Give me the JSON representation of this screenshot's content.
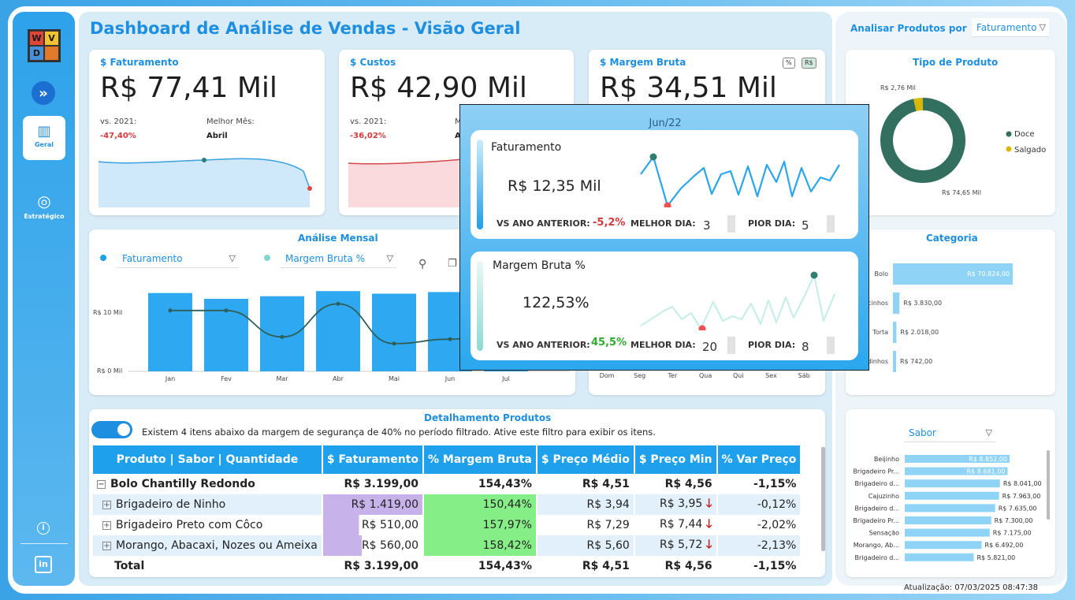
{
  "app": {
    "title": "Dashboard de Análise de Vendas - Visão Geral",
    "update": "Atualização: 07/03/2025 08:47:38"
  },
  "sidebar": {
    "logo_letters": [
      "W",
      "V",
      "D",
      ""
    ],
    "nav": [
      {
        "label": "Geral",
        "icon": "bar-chart-add-icon"
      },
      {
        "label": "Estratégico",
        "icon": "target-icon"
      }
    ]
  },
  "kpis": {
    "faturamento": {
      "label": "$ Faturamento",
      "value": "R$ 77,41 Mil",
      "vs_label": "vs. 2021:",
      "vs_value": "-47,40%",
      "best_label": "Melhor Mês:",
      "best_value": "Abril"
    },
    "custos": {
      "label": "$ Custos",
      "value": "R$ 42,90 Mil",
      "vs_label": "vs. 2021:",
      "vs_value": "-36,02%",
      "best_label": "M",
      "best_value": "A"
    },
    "margem": {
      "label": "$ Margem Bruta",
      "value": "R$ 34,51 Mil",
      "btn_pct": "%",
      "btn_rs": "R$"
    }
  },
  "monthly": {
    "title": "Análise Mensal",
    "dd1": "Faturamento",
    "dd2": "Margem Bruta %",
    "y_labels": [
      "R$ 10 Mil",
      "R$ 0 Mil"
    ],
    "chart_data": {
      "type": "bar",
      "categories": [
        "Jan",
        "Fev",
        "Mar",
        "Abr",
        "Mai",
        "Jun",
        "Jul"
      ],
      "values": [
        12.2,
        11.3,
        11.7,
        12.5,
        12.1,
        12.35,
        6.0
      ],
      "line_values": [
        145,
        145,
        85,
        160,
        70,
        80,
        100
      ],
      "ylim": [
        0,
        14
      ]
    }
  },
  "weekday": {
    "categories": [
      "Dom",
      "Seg",
      "Ter",
      "Qua",
      "Qui",
      "Sex",
      "Sáb"
    ]
  },
  "tooltip": {
    "title": "Jun/22",
    "fat": {
      "label": "Faturamento",
      "value": "R$ 12,35 Mil",
      "vs_label": "VS ANO ANTERIOR:",
      "vs_value": "-5,2%",
      "best_label": "MELHOR DIA:",
      "best_value": "3",
      "worst_label": "PIOR DIA:",
      "worst_value": "5"
    },
    "mar": {
      "label": "Margem Bruta %",
      "value": "122,53%",
      "vs_label": "VS ANO ANTERIOR:",
      "vs_value": "45,5%",
      "best_label": "MELHOR DIA:",
      "best_value": "20",
      "worst_label": "PIOR DIA:",
      "worst_value": "8"
    }
  },
  "products": {
    "title": "Detalhamento Produtos",
    "toggle_text": "Existem 4 itens abaixo da margem de segurança de 40% no período filtrado. Ative este filtro para exibir os itens.",
    "headers": [
      "Produto | Sabor | Quantidade",
      "$ Faturamento",
      "% Margem Bruta",
      "$ Preço Médio",
      "$ Preço Min",
      "% Var Preço"
    ],
    "group": {
      "name": "Bolo Chantilly Redondo",
      "fat": "R$ 3.199,00",
      "margem": "154,43%",
      "medio": "R$ 4,51",
      "min": "R$ 4,56",
      "var": "-1,15%"
    },
    "rows": [
      {
        "name": "Brigadeiro de Ninho",
        "fat": "R$ 1.419,00",
        "fat_pct": 1.0,
        "margem": "150,44%",
        "medio": "R$ 3,94",
        "min": "R$ 3,95",
        "var": "-0,12%"
      },
      {
        "name": "Brigadeiro Preto com Côco",
        "fat": "R$ 510,00",
        "fat_pct": 0.36,
        "margem": "157,97%",
        "medio": "R$ 7,29",
        "min": "R$ 7,44",
        "var": "-2,02%"
      },
      {
        "name": "Morango, Abacaxi, Nozes ou Ameixa",
        "fat": "R$ 560,00",
        "fat_pct": 0.39,
        "margem": "158,42%",
        "medio": "R$ 5,60",
        "min": "R$ 5,72",
        "var": "-2,13%"
      }
    ],
    "total": {
      "name": "Total",
      "fat": "R$ 3.199,00",
      "margem": "154,43%",
      "medio": "R$ 4,51",
      "min": "R$ 4,56",
      "var": "-1,15%"
    }
  },
  "right": {
    "label": "Analisar Produtos por",
    "dd": "Faturamento",
    "tipo": {
      "title": "Tipo de Produto",
      "chart_data": {
        "type": "pie",
        "categories": [
          "Doce",
          "Salgado"
        ],
        "values": [
          74.65,
          2.76
        ],
        "labels": [
          "R$ 74,65 Mil",
          "R$ 2,76 Mil"
        ]
      }
    },
    "categoria": {
      "title": "Categoria",
      "chart_data": {
        "type": "bar",
        "categories": [
          "Bolo",
          "cinhos",
          "Torta",
          "dinhos"
        ],
        "values": [
          70824,
          3830,
          2018,
          742
        ],
        "labels": [
          "R$ 70.824,00",
          "R$ 3.830,00",
          "R$ 2.018,00",
          "R$ 742,00"
        ]
      }
    },
    "sabor": {
      "dd": "Sabor",
      "chart_data": {
        "type": "bar",
        "categories": [
          "Beijinho",
          "Brigadeiro Pr...",
          "Brigadeiro d...",
          "Cajuzinho",
          "Brigadeiro d...",
          "Brigadeiro Pr...",
          "Sensação",
          "Morango, Ab...",
          "Brigadeiro d..."
        ],
        "values": [
          8852,
          8681,
          8041,
          7963,
          7635,
          7300,
          7175,
          6492,
          5821
        ],
        "labels": [
          "R$ 8.852,00",
          "R$ 8.681,00",
          "R$ 8.041,00",
          "R$ 7.963,00",
          "R$ 7.635,00",
          "R$ 7.300,00",
          "R$ 7.175,00",
          "R$ 6.492,00",
          "R$ 5.821,00"
        ]
      }
    }
  },
  "colors": {
    "accent": "#1e8fe0",
    "bar": "#2ea8f0",
    "line": "#2f5f5a",
    "doce": "#336f5e",
    "salgado": "#d8b800",
    "cat_bar": "#8fd3f7"
  }
}
